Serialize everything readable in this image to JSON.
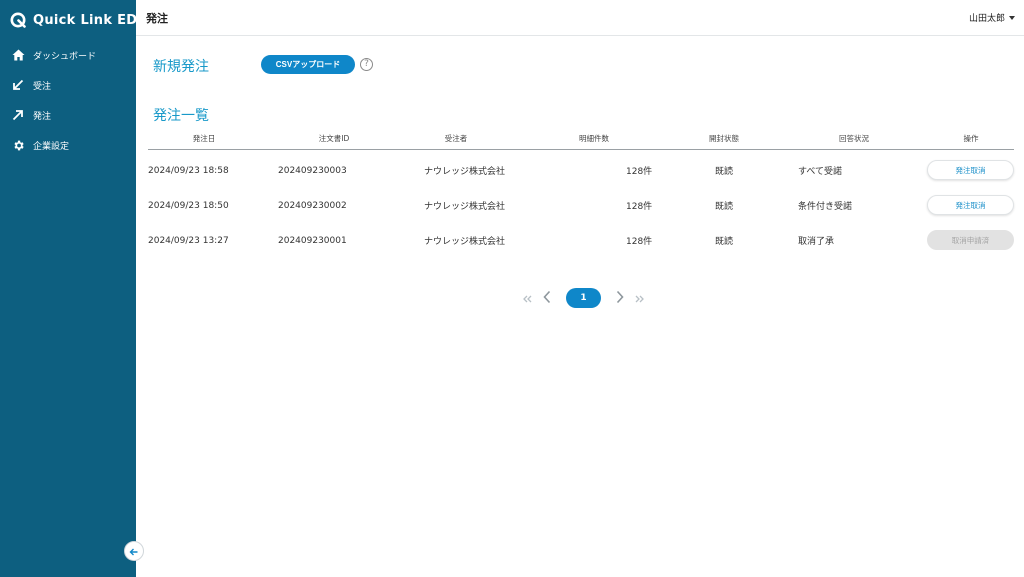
{
  "app": {
    "name": "Quick Link EDI"
  },
  "sidebar": {
    "items": [
      {
        "label": "ダッシュボード",
        "icon": "home-icon"
      },
      {
        "label": "受注",
        "icon": "arrow-down-left-icon"
      },
      {
        "label": "発注",
        "icon": "arrow-up-right-icon"
      },
      {
        "label": "企業設定",
        "icon": "gear-icon"
      }
    ],
    "collapse_icon": "arrow-left-icon"
  },
  "header": {
    "title": "発注",
    "user": "山田太郎"
  },
  "new_order": {
    "title": "新規発注",
    "csv_button": "CSVアップロード",
    "help": "?"
  },
  "order_list": {
    "title": "発注一覧",
    "columns": [
      "発注日",
      "注文書ID",
      "受注者",
      "明細件数",
      "開封状態",
      "回答状況",
      "操作"
    ],
    "rows": [
      {
        "date": "2024/09/23 18:58",
        "order_id": "202409230003",
        "receiver": "ナウレッジ株式会社",
        "count": "128件",
        "open_status": "既読",
        "answer_status": "すべて受諾",
        "action": "発注取消",
        "action_enabled": true
      },
      {
        "date": "2024/09/23 18:50",
        "order_id": "202409230002",
        "receiver": "ナウレッジ株式会社",
        "count": "128件",
        "open_status": "既読",
        "answer_status": "条件付き受諾",
        "action": "発注取消",
        "action_enabled": true
      },
      {
        "date": "2024/09/23 13:27",
        "order_id": "202409230001",
        "receiver": "ナウレッジ株式会社",
        "count": "128件",
        "open_status": "既読",
        "answer_status": "取消了承",
        "action": "取消申請済",
        "action_enabled": false
      }
    ]
  },
  "pagination": {
    "current": "1",
    "first": "«",
    "prev": "‹",
    "next": "›",
    "last": "»"
  },
  "colors": {
    "sidebar": "#0d5f80",
    "accent": "#0f87c9",
    "title": "#1899c9",
    "disabled": "#e2e2e2"
  }
}
